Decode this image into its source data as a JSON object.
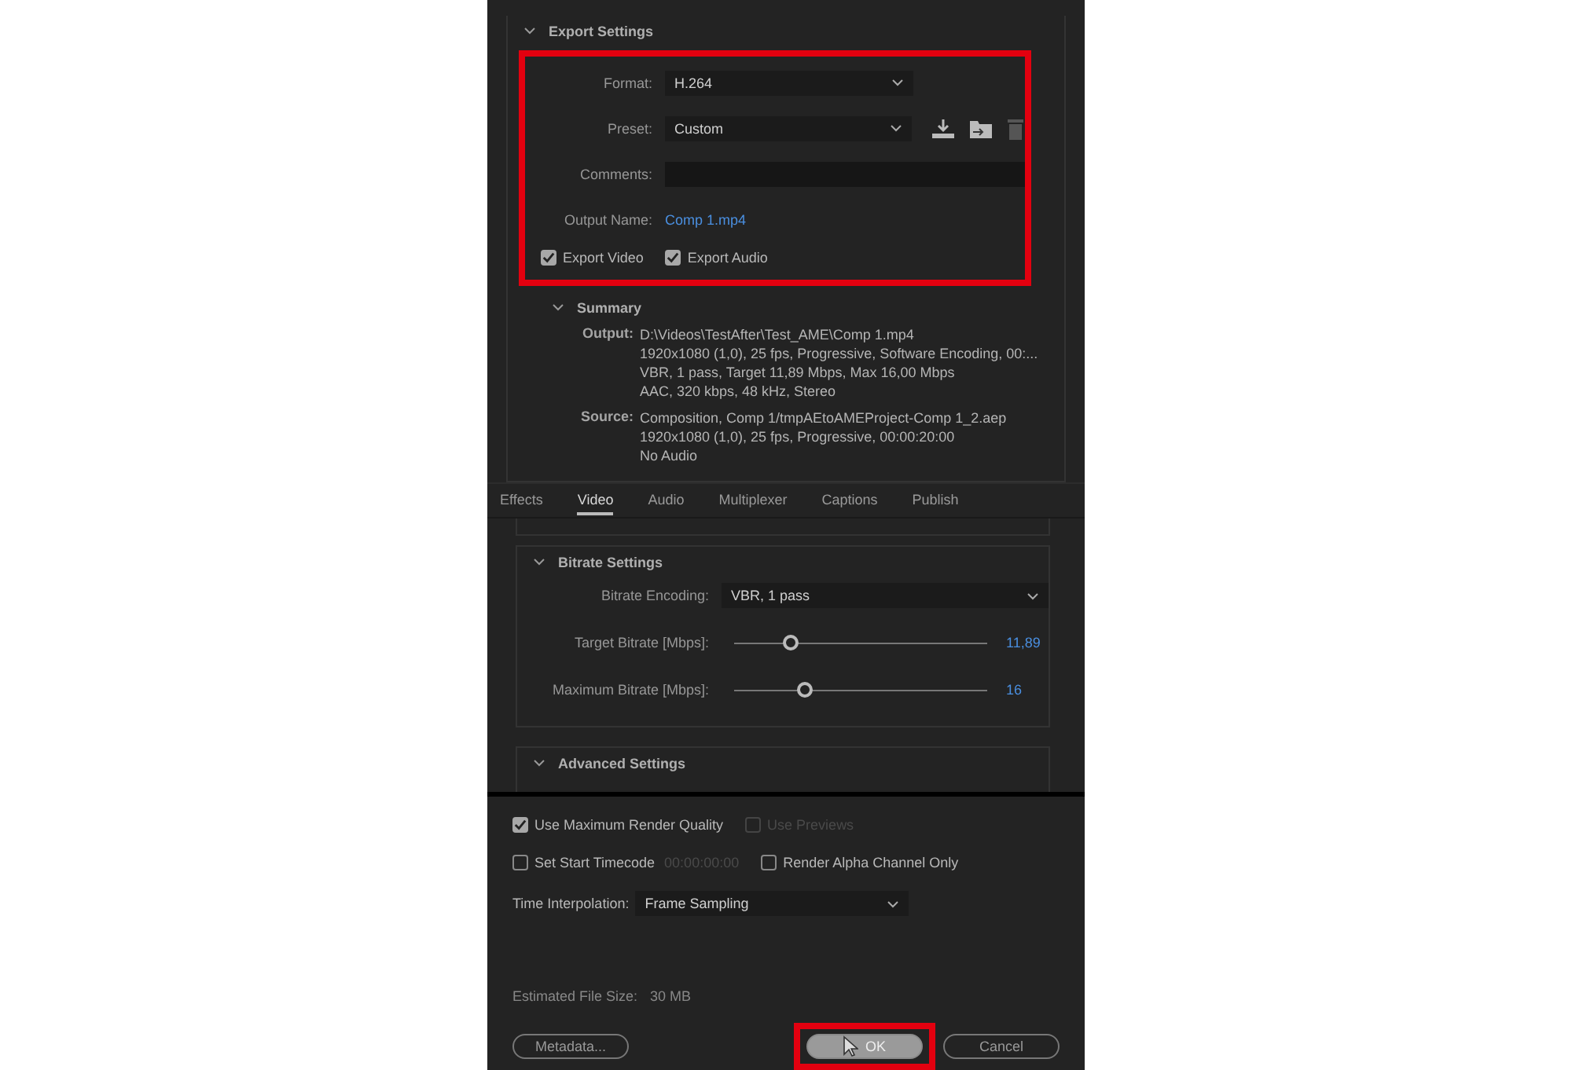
{
  "export_settings": {
    "title": "Export Settings",
    "expanded": true,
    "highlighted": true,
    "format": {
      "label": "Format:",
      "value": "H.264"
    },
    "preset": {
      "label": "Preset:",
      "value": "Custom"
    },
    "comments": {
      "label": "Comments:"
    },
    "output_name": {
      "label": "Output Name:",
      "value": "Comp 1.mp4"
    },
    "checkboxes": [
      {
        "label": "Export Video",
        "checked": true
      },
      {
        "label": "Export Audio",
        "checked": true
      }
    ]
  },
  "summary": {
    "title": "Summary",
    "expanded": true,
    "items": [
      {
        "label": "Output:",
        "lines": [
          "D:\\Videos\\TestAfter\\Test_AME\\Comp 1.mp4",
          "1920x1080 (1,0), 25 fps, Progressive, Software Encoding, 00:...",
          "VBR, 1 pass, Target 11,89 Mbps, Max 16,00 Mbps",
          "AAC, 320 kbps, 48 kHz, Stereo"
        ]
      },
      {
        "label": "Source:",
        "lines": [
          "Composition, Comp 1/tmpAEtoAMEProject-Comp 1_2.aep",
          "1920x1080 (1,0), 25 fps, Progressive, 00:00:20:00",
          "No Audio"
        ]
      }
    ]
  },
  "tabs": [
    {
      "label": "Effects",
      "selected": false
    },
    {
      "label": "Video",
      "selected": true
    },
    {
      "label": "Audio",
      "selected": false
    },
    {
      "label": "Multiplexer",
      "selected": false
    },
    {
      "label": "Captions",
      "selected": false
    },
    {
      "label": "Publish",
      "selected": false
    }
  ],
  "bitrate_settings": {
    "title": "Bitrate Settings",
    "expanded": true,
    "encoding": {
      "label": "Bitrate Encoding:",
      "value": "VBR, 1 pass"
    },
    "sliders": [
      {
        "label": "Target Bitrate [Mbps]:",
        "level": 0.19,
        "reading": "11,89"
      },
      {
        "label": "Maximum Bitrate [Mbps]:",
        "level": 0.25,
        "reading": "16"
      }
    ]
  },
  "advanced_settings": {
    "title": "Advanced Settings",
    "expanded": true
  },
  "options": [
    [
      {
        "label": "Use Maximum Render Quality",
        "checked": true,
        "disabled": false
      },
      {
        "label": "Use Previews",
        "checked": false,
        "disabled": true
      }
    ],
    [
      {
        "label": "Set Start Timecode",
        "checked": false,
        "disabled": false,
        "timecode": "00:00:00:00"
      },
      {
        "label": "Render Alpha Channel Only",
        "checked": false,
        "disabled": false
      }
    ]
  ],
  "time_interpolation": {
    "label": "Time Interpolation:",
    "value": "Frame Sampling"
  },
  "estimated_file_size": {
    "label": "Estimated File Size:",
    "value": "30 MB"
  },
  "buttons": [
    {
      "label": "Metadata...",
      "kind": "secondary",
      "highlighted": false,
      "hovered": false
    },
    {
      "label": "OK",
      "kind": "primary",
      "highlighted": true,
      "hovered": true
    },
    {
      "label": "Cancel",
      "kind": "secondary",
      "highlighted": false,
      "hovered": false
    }
  ]
}
